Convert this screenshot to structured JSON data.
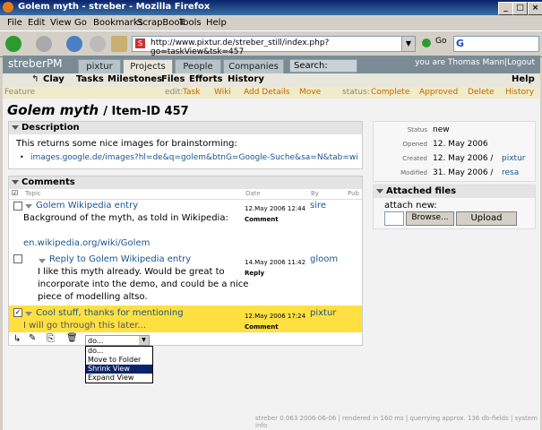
{
  "window": {
    "title": "Golem myth - streber - Mozilla Firefox",
    "buttons": [
      "_",
      "□",
      "×"
    ]
  },
  "menu": [
    "File",
    "Edit",
    "View",
    "Go",
    "Bookmarks",
    "ScrapBook",
    "Tools",
    "Help"
  ],
  "toolbar": {
    "url": "http://www.pixtur.de/streber_still/index.php?go=taskView&tsk=457",
    "go_label": "Go",
    "search_logo": "G"
  },
  "app": {
    "logo": "streberPM",
    "tabs": [
      "pixtur",
      "Projects",
      "People",
      "Companies"
    ],
    "search_label": "Search:",
    "user_text": "you are Thomas Mann|Logout",
    "subnav": {
      "project": "Clay",
      "items": [
        "Tasks",
        "Milestones",
        "Files",
        "Efforts",
        "History"
      ],
      "help": "Help"
    },
    "actionbar": {
      "feature": "Feature",
      "edit_label": "edit:",
      "edit_items": [
        "Task",
        "Wiki",
        "Add Details",
        "Move"
      ],
      "status_label": "status:",
      "status_items": [
        "Complete",
        "Approved",
        "Delete",
        "History"
      ]
    },
    "title": "Golem myth",
    "item_id": "/ Item-ID 457"
  },
  "description": {
    "heading": "Description",
    "text": "This returns some nice images for brainstorming:",
    "link": "images.google.de/images?hl=de&q=golem&btnG=Google-Suche&sa=N&tab=wi"
  },
  "comments": {
    "heading": "Comments",
    "columns": [
      "Topic",
      "Date",
      "By",
      "Pub"
    ],
    "items": [
      {
        "title": "Golem Wikipedia entry",
        "body1": "Background of the myth, as told in Wikipedia:",
        "body2": "en.wikipedia.org/wiki/Golem",
        "date": "12.May 2006 12:44",
        "kind": "Comment",
        "author": "sire"
      },
      {
        "title": "Reply to Golem Wikipedia entry",
        "body1": "I like this myth already. Would be great to",
        "body2": "incorporate into the demo, and could be a nice",
        "body3": "piece of modelling altso.",
        "date": "14.May 2006 11:42",
        "kind": "Reply",
        "author": "gloom"
      },
      {
        "title": "Cool stuff, thanks for mentioning",
        "body1": "I will go through this later...",
        "date": "12.May 2006 17:24",
        "kind": "Comment",
        "author": "pixtur"
      }
    ],
    "select_value": "do...",
    "options": [
      "do...",
      "Move to Folder",
      "Shrink View",
      "Expand View"
    ]
  },
  "meta": {
    "status_label": "Status",
    "status": "new",
    "opened_label": "Opened",
    "opened": "12. May 2006",
    "created_label": "Created",
    "created": "12. May 2006 /",
    "created_by": "pixtur",
    "modified_label": "Modified",
    "modified": "31. May 2006 /",
    "modified_by": "resa"
  },
  "files": {
    "heading": "Attached files",
    "attach_label": "attach new:",
    "browse": "Browse...",
    "upload": "Upload"
  },
  "footer": "streber 0.063 2006-06-06 | rendered in 160 ms | querrying approx. 136 db-fields | system info",
  "colors": {
    "title_bar": "#0a246a",
    "nav": "#7a8b95",
    "highlight_row": "#ffe040",
    "action": "#c86400",
    "link": "#1a5490"
  }
}
